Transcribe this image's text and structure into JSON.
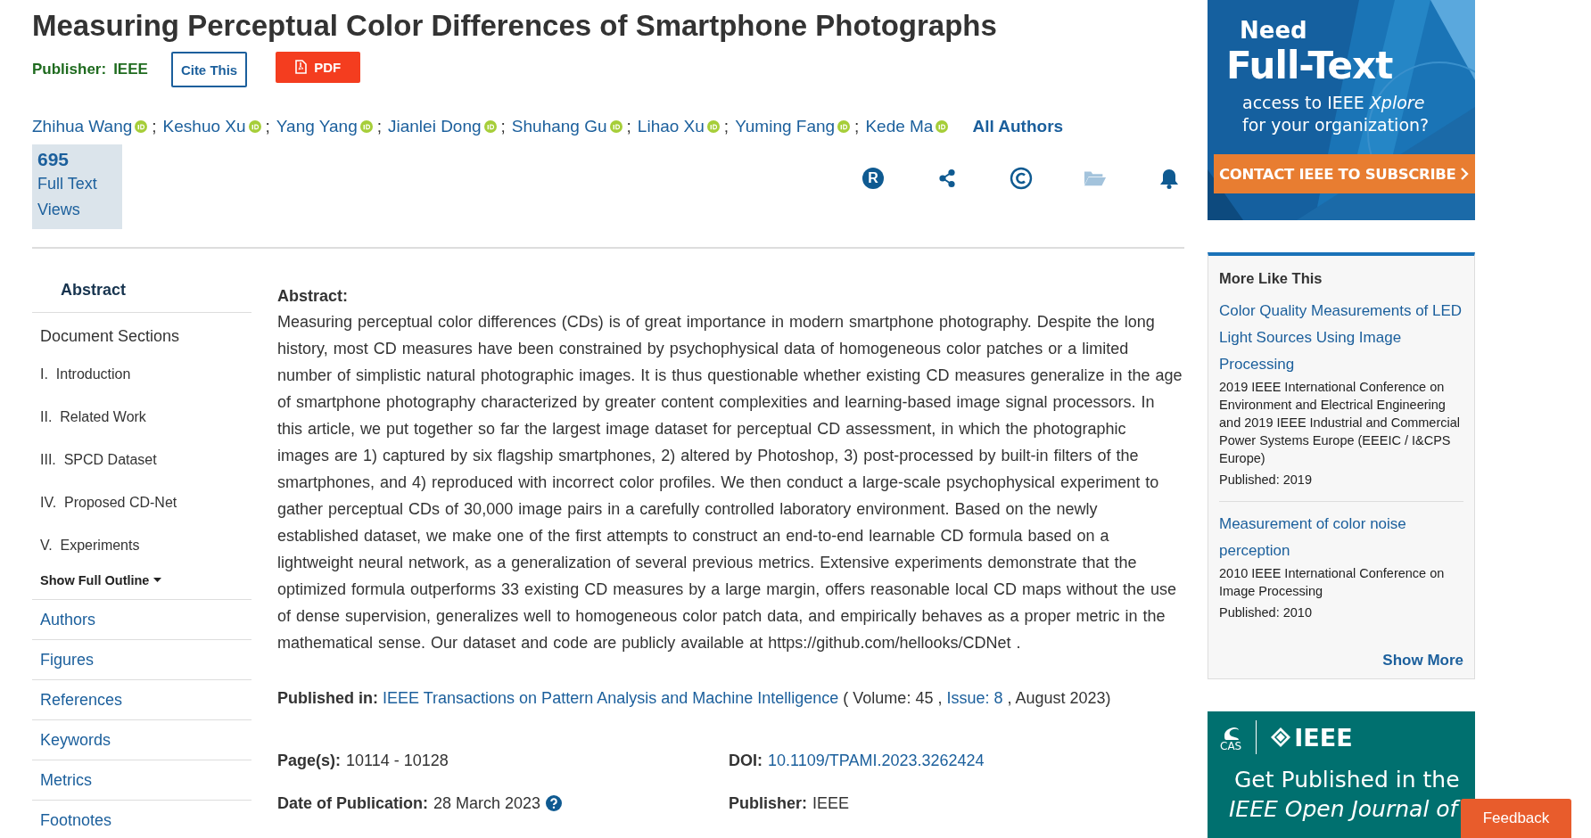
{
  "title": "Measuring Perceptual Color Differences of Smartphone Photographs",
  "publisher": {
    "label": "Publisher:",
    "value": "IEEE"
  },
  "actions": [
    {
      "kind": "cite",
      "label": "Cite This"
    },
    {
      "kind": "pdf",
      "label": "PDF"
    }
  ],
  "authors": [
    {
      "name": "Zhihua Wang"
    },
    {
      "name": "Keshuo Xu"
    },
    {
      "name": "Yang Yang"
    },
    {
      "name": "Jianlei Dong"
    },
    {
      "name": "Shuhang Gu"
    },
    {
      "name": "Lihao Xu"
    },
    {
      "name": "Yuming Fang"
    },
    {
      "name": "Kede Ma"
    }
  ],
  "author_separator": ";",
  "all_authors": "All Authors",
  "views": {
    "count": "695",
    "label": "Full Text Views"
  },
  "tools": [
    {
      "kind": "rights",
      "glyph": "R",
      "disabled": false
    },
    {
      "kind": "share",
      "disabled": false
    },
    {
      "kind": "copyright",
      "disabled": false
    },
    {
      "kind": "folder",
      "disabled": true
    },
    {
      "kind": "alert",
      "disabled": false
    }
  ],
  "nav": [
    {
      "kind": "tab",
      "label": "Abstract",
      "selected": true
    },
    {
      "kind": "heading",
      "label": "Document Sections",
      "selected": false
    },
    {
      "kind": "section",
      "number": "I.",
      "label": "Introduction",
      "selected": false
    },
    {
      "kind": "section",
      "number": "II.",
      "label": "Related Work",
      "selected": false
    },
    {
      "kind": "section",
      "number": "III.",
      "label": "SPCD Dataset",
      "selected": false
    },
    {
      "kind": "section",
      "number": "IV.",
      "label": "Proposed CD-Net",
      "selected": false
    },
    {
      "kind": "section",
      "number": "V.",
      "label": "Experiments",
      "selected": false
    },
    {
      "kind": "toggle",
      "label": "Show Full Outline",
      "selected": false
    },
    {
      "kind": "link",
      "label": "Authors",
      "selected": false
    },
    {
      "kind": "link",
      "label": "Figures",
      "selected": false
    },
    {
      "kind": "link",
      "label": "References",
      "selected": false
    },
    {
      "kind": "link",
      "label": "Keywords",
      "selected": false
    },
    {
      "kind": "link",
      "label": "Metrics",
      "selected": false
    },
    {
      "kind": "link",
      "label": "Footnotes",
      "selected": false
    }
  ],
  "abstract": {
    "heading": "Abstract:",
    "text": "Measuring perceptual color differences (CDs) is of great importance in modern smartphone photography. Despite the long history, most CD measures have been constrained by psychophysical data of homogeneous color patches or a limited number of simplistic natural photographic images. It is thus questionable whether existing CD measures generalize in the age of smartphone photography characterized by greater content complexities and learning-based image signal processors. In this article, we put together so far the largest image dataset for perceptual CD assessment, in which the photographic images are 1) captured by six flagship smartphones, 2) altered by Photoshop, 3) post-processed by built-in filters of the smartphones, and 4) reproduced with incorrect color profiles. We then conduct a large-scale psychophysical experiment to gather perceptual CDs of 30,000 image pairs in a carefully controlled laboratory environment. Based on the newly established dataset, we make one of the first attempts to construct an end-to-end learnable CD formula based on a lightweight neural network, as a generalization of several previous metrics. Extensive experiments demonstrate that the optimized formula outperforms 33 existing CD measures by a large margin, offers reasonable local CD maps without the use of dense supervision, generalizes well to homogeneous color patch data, and empirically behaves as a proper metric in the mathematical sense. Our dataset and code are publicly available at https://github.com/hellooks/CDNet ."
  },
  "published_in": [
    {
      "kind": "label",
      "text": "Published in:"
    },
    {
      "kind": "link",
      "text": "IEEE Transactions on Pattern Analysis and Machine Intelligence"
    },
    {
      "kind": "text",
      "text": "( Volume: 45 ,"
    },
    {
      "kind": "link",
      "text": "Issue: 8"
    },
    {
      "kind": "text",
      "text": ", August 2023)"
    }
  ],
  "details": [
    {
      "label": "Page(s):",
      "value": "10114 - 10128",
      "kind": "text"
    },
    {
      "label": "DOI:",
      "value": "10.1109/TPAMI.2023.3262424",
      "kind": "link"
    },
    {
      "label": "Date of Publication:",
      "value": "28 March 2023",
      "kind": "help"
    },
    {
      "label": "Publisher:",
      "value": "IEEE",
      "kind": "text"
    }
  ],
  "ad": {
    "lines": [
      "Need",
      "Full-Text"
    ],
    "subtitle": "access to IEEE *Xplore* for your organization?",
    "cta": "CONTACT IEEE TO SUBSCRIBE"
  },
  "more_like_this": {
    "heading": "More Like This",
    "items": [
      {
        "title": "Color Quality Measurements of LED Light Sources Using Image Processing",
        "venue": "2019 IEEE International Conference on Environment and Electrical Engineering and 2019 IEEE Industrial and Commercial Power Systems Europe (EEEIC / I&CPS Europe)",
        "published": "Published: 2019"
      },
      {
        "title": "Measurement of color noise perception",
        "venue": "2010 IEEE International Conference on Image Processing",
        "published": "Published: 2010"
      }
    ],
    "show_more": "Show More"
  },
  "promo": {
    "logos": [
      "CAS",
      "IEEE"
    ],
    "lines": [
      "Get Published in the",
      "IEEE Open Journal of"
    ]
  },
  "feedback": "Feedback"
}
